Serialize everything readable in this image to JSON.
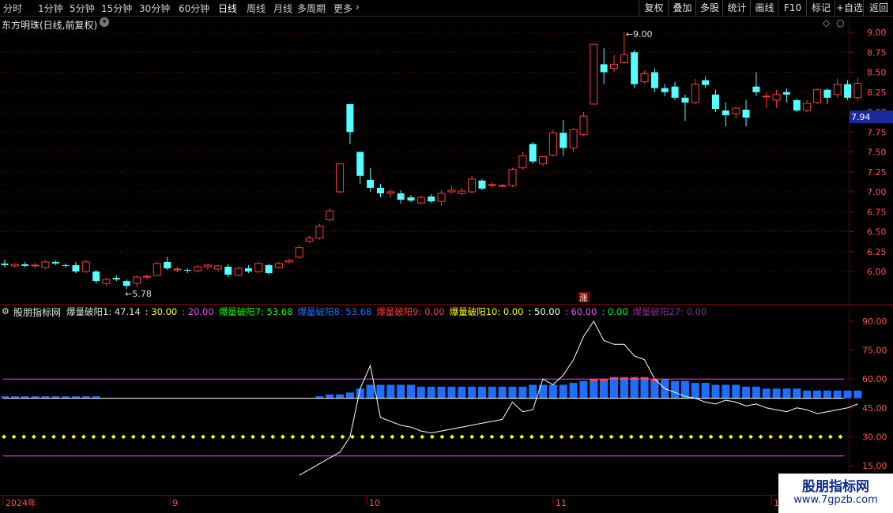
{
  "toolbar": {
    "periods": [
      "分时",
      "1分钟",
      "5分钟",
      "15分钟",
      "30分钟",
      "60分钟",
      "日线",
      "周线",
      "月线",
      "多周期",
      "更多"
    ],
    "active_period": "日线",
    "more_arrow": "chevron-right-icon",
    "right_buttons": [
      "复权",
      "叠加",
      "多股",
      "统计",
      "画线",
      "F10",
      "标记",
      "+自选",
      "返回"
    ]
  },
  "main_panel": {
    "title": "东方明珠(日线,前复权)",
    "title_dropdown_icon": "chevron-down-icon",
    "corner_icon": "diamond-icon",
    "price_ticks": [
      "9.00",
      "8.75",
      "8.50",
      "8.25",
      "8.00",
      "7.75",
      "7.50",
      "7.25",
      "7.00",
      "6.75",
      "6.50",
      "6.25",
      "6.00"
    ],
    "current_price": "7.94",
    "high_label": "9.00",
    "low_label": "5.78",
    "zhang_badge": "涨",
    "colors": {
      "up": "#ff3b3b",
      "down": "#54ffff",
      "grid": "#8b0000"
    }
  },
  "indicator_panel": {
    "name": "股朋指标网",
    "legend": [
      {
        "text": "爆量破阳1: 47.14",
        "color": "#e0e0e0"
      },
      {
        "text": ": 30.00",
        "color": "#ffff00"
      },
      {
        "text": ": 20.00",
        "color": "#ff44ff"
      },
      {
        "text": "爆量破阳7: 53.68",
        "color": "#00ff00"
      },
      {
        "text": "爆量破阳8: 53.68",
        "color": "#1e6eff"
      },
      {
        "text": "爆量破阳9: 0.00",
        "color": "#ff3b3b"
      },
      {
        "text": "爆量破阳10: 0.00",
        "color": "#ffff00"
      },
      {
        "text": ": 50.00",
        "color": "#ffffff"
      },
      {
        "text": ": 60.00",
        "color": "#ff44ff"
      },
      {
        "text": ": 0.00",
        "color": "#00ff00"
      },
      {
        "text": "爆量破阳27: 0.00",
        "color": "#8a2b8a"
      }
    ],
    "y_ticks": [
      "90.00",
      "75.00",
      "60.00",
      "45.00",
      "30.00",
      "15.00"
    ],
    "colors": {
      "line": "#ffffff",
      "bar": "#1e6eff",
      "bar_hi": "#ff3b3b",
      "magenta": "#ff44ff",
      "yellow": "#ffff00"
    }
  },
  "date_axis": {
    "labels": [
      "2024年",
      "9",
      "10",
      "11",
      "1"
    ]
  },
  "watermark": {
    "line1": "股朋指标网",
    "line2": "www.7gpzb.com"
  },
  "chart_data": {
    "type": "candlestick",
    "ylim": [
      5.6,
      9.2
    ],
    "candles": [
      [
        6.1,
        6.15,
        6.05,
        6.08
      ],
      [
        6.07,
        6.1,
        6.05,
        6.09
      ],
      [
        6.09,
        6.12,
        6.05,
        6.07
      ],
      [
        6.08,
        6.11,
        6.04,
        6.08
      ],
      [
        6.05,
        6.14,
        6.03,
        6.12
      ],
      [
        6.12,
        6.14,
        6.08,
        6.1
      ],
      [
        6.08,
        6.1,
        6.05,
        6.07
      ],
      [
        6.08,
        6.12,
        5.98,
        6.0
      ],
      [
        6.0,
        6.15,
        5.98,
        6.12
      ],
      [
        6.0,
        6.02,
        5.85,
        5.88
      ],
      [
        5.85,
        5.92,
        5.82,
        5.9
      ],
      [
        5.92,
        5.95,
        5.88,
        5.9
      ],
      [
        5.88,
        5.9,
        5.78,
        5.82
      ],
      [
        5.85,
        5.95,
        5.8,
        5.93
      ],
      [
        5.93,
        5.96,
        5.9,
        5.94
      ],
      [
        5.95,
        6.12,
        5.94,
        6.1
      ],
      [
        6.12,
        6.18,
        6.02,
        6.04
      ],
      [
        6.02,
        6.06,
        5.99,
        6.03
      ],
      [
        6.02,
        6.04,
        5.98,
        6.01
      ],
      [
        6.01,
        6.08,
        5.99,
        6.06
      ],
      [
        6.06,
        6.1,
        6.02,
        6.08
      ],
      [
        6.03,
        6.08,
        6.0,
        6.07
      ],
      [
        6.06,
        6.09,
        5.93,
        5.96
      ],
      [
        5.95,
        6.06,
        5.94,
        6.04
      ],
      [
        6.04,
        6.08,
        5.98,
        6.0
      ],
      [
        6.0,
        6.12,
        5.98,
        6.1
      ],
      [
        6.08,
        6.1,
        5.96,
        5.98
      ],
      [
        6.05,
        6.12,
        6.04,
        6.1
      ],
      [
        6.12,
        6.16,
        6.1,
        6.14
      ],
      [
        6.18,
        6.33,
        6.16,
        6.3
      ],
      [
        6.38,
        6.45,
        6.36,
        6.42
      ],
      [
        6.42,
        6.6,
        6.4,
        6.57
      ],
      [
        6.65,
        6.8,
        6.63,
        6.76
      ],
      [
        7.0,
        7.35,
        6.98,
        7.35
      ],
      [
        8.1,
        8.1,
        7.6,
        7.75
      ],
      [
        7.5,
        7.5,
        7.1,
        7.2
      ],
      [
        7.15,
        7.3,
        7.0,
        7.05
      ],
      [
        7.05,
        7.1,
        6.93,
        6.98
      ],
      [
        6.98,
        7.03,
        6.93,
        7.0
      ],
      [
        6.98,
        7.02,
        6.85,
        6.9
      ],
      [
        6.93,
        6.96,
        6.87,
        6.89
      ],
      [
        6.86,
        6.95,
        6.84,
        6.93
      ],
      [
        6.94,
        6.97,
        6.86,
        6.88
      ],
      [
        6.88,
        7.02,
        6.82,
        6.98
      ],
      [
        7.0,
        7.08,
        6.98,
        7.02
      ],
      [
        6.98,
        7.05,
        6.96,
        7.01
      ],
      [
        7.0,
        7.2,
        6.98,
        7.16
      ],
      [
        7.14,
        7.16,
        7.02,
        7.04
      ],
      [
        7.08,
        7.12,
        7.05,
        7.09
      ],
      [
        7.08,
        7.1,
        7.06,
        7.08
      ],
      [
        7.08,
        7.3,
        7.06,
        7.28
      ],
      [
        7.3,
        7.5,
        7.28,
        7.45
      ],
      [
        7.6,
        7.62,
        7.35,
        7.38
      ],
      [
        7.35,
        7.45,
        7.32,
        7.44
      ],
      [
        7.46,
        7.78,
        7.44,
        7.74
      ],
      [
        7.74,
        7.9,
        7.45,
        7.55
      ],
      [
        7.55,
        7.8,
        7.5,
        7.78
      ],
      [
        7.72,
        8.0,
        7.7,
        7.95
      ],
      [
        8.1,
        8.85,
        8.1,
        8.85
      ],
      [
        8.6,
        8.8,
        8.35,
        8.5
      ],
      [
        8.55,
        8.72,
        8.5,
        8.6
      ],
      [
        8.62,
        9.0,
        8.6,
        8.72
      ],
      [
        8.75,
        8.78,
        8.3,
        8.35
      ],
      [
        8.38,
        8.52,
        8.36,
        8.48
      ],
      [
        8.5,
        8.55,
        8.25,
        8.3
      ],
      [
        8.3,
        8.35,
        8.2,
        8.25
      ],
      [
        8.32,
        8.38,
        8.15,
        8.18
      ],
      [
        8.18,
        8.22,
        7.89,
        8.12
      ],
      [
        8.12,
        8.42,
        8.1,
        8.35
      ],
      [
        8.4,
        8.45,
        8.3,
        8.34
      ],
      [
        8.22,
        8.28,
        8.0,
        8.04
      ],
      [
        8.02,
        8.12,
        7.82,
        7.96
      ],
      [
        7.98,
        8.06,
        7.92,
        8.05
      ],
      [
        8.03,
        8.15,
        7.82,
        7.93
      ],
      [
        8.32,
        8.5,
        8.2,
        8.25
      ],
      [
        8.2,
        8.25,
        8.05,
        8.2
      ],
      [
        8.15,
        8.28,
        8.05,
        8.22
      ],
      [
        8.25,
        8.3,
        8.12,
        8.22
      ],
      [
        8.15,
        8.17,
        8.0,
        8.02
      ],
      [
        8.02,
        8.15,
        8.0,
        8.11
      ],
      [
        8.12,
        8.3,
        8.1,
        8.28
      ],
      [
        8.28,
        8.3,
        8.1,
        8.18
      ],
      [
        8.22,
        8.42,
        8.18,
        8.35
      ],
      [
        8.35,
        8.4,
        8.15,
        8.18
      ],
      [
        8.18,
        8.43,
        8.15,
        8.36
      ]
    ],
    "indicator": {
      "ylim": [
        10,
        96
      ],
      "line": [
        null,
        null,
        null,
        null,
        null,
        null,
        null,
        null,
        null,
        null,
        null,
        null,
        null,
        null,
        null,
        null,
        null,
        null,
        null,
        null,
        null,
        null,
        null,
        null,
        null,
        null,
        null,
        null,
        null,
        10,
        13,
        16,
        19,
        22,
        30,
        55,
        67,
        40,
        38,
        36,
        35,
        33,
        32,
        33,
        34,
        35,
        36,
        37,
        38,
        39,
        48,
        43,
        44,
        60,
        57,
        62,
        70,
        82,
        90,
        80,
        78,
        78,
        72,
        70,
        60,
        55,
        53,
        51,
        50,
        48,
        47,
        49,
        48,
        46,
        47,
        45,
        44,
        43,
        45,
        44,
        42,
        43,
        44,
        45,
        47
      ],
      "bars": [
        51,
        51,
        51,
        51,
        51,
        51,
        51,
        51,
        51,
        51,
        null,
        null,
        null,
        null,
        null,
        null,
        null,
        null,
        null,
        null,
        null,
        null,
        null,
        null,
        null,
        null,
        null,
        null,
        null,
        null,
        null,
        51,
        52,
        52,
        53,
        55,
        57,
        57,
        57,
        57,
        57,
        56,
        56,
        56,
        56,
        56,
        56,
        56,
        56,
        56,
        56,
        56,
        57,
        57,
        57,
        57,
        58,
        59,
        60,
        60,
        61,
        61,
        61,
        61,
        60,
        60,
        59,
        59,
        58,
        58,
        57,
        57,
        57,
        56,
        56,
        55,
        55,
        55,
        55,
        54,
        54,
        54,
        54,
        54,
        54
      ],
      "bar_hi_from": 58,
      "bar_hi_to": 64,
      "white_level": 50,
      "magenta_levels": [
        60,
        20
      ],
      "yellow_level": 30
    }
  }
}
